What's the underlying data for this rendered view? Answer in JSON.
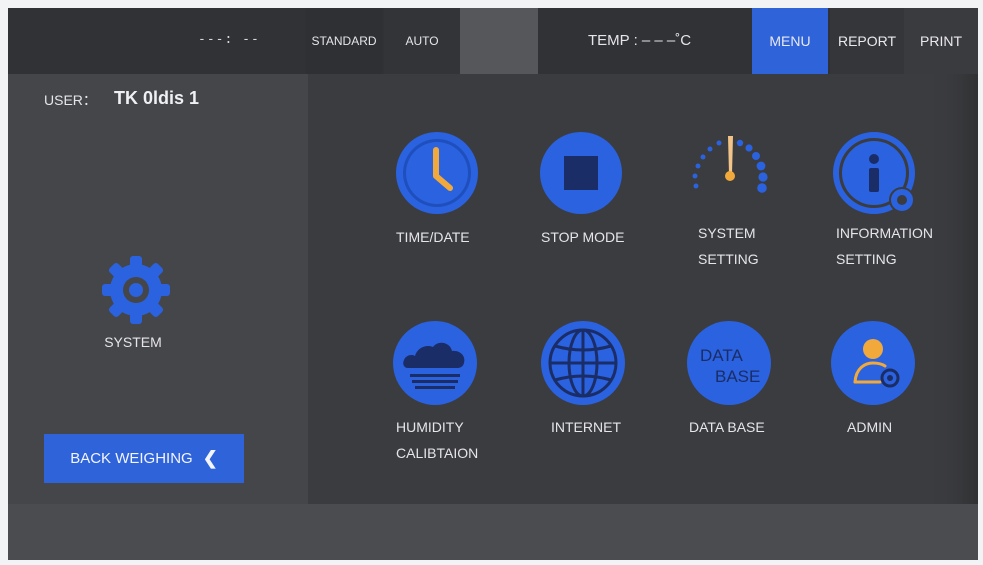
{
  "topbar": {
    "time": "---: --",
    "mode_standard": "STANDARD",
    "mode_auto": "AUTO",
    "temp": "TEMP  : – – –˚C",
    "tabs": [
      "MENU",
      "REPORT",
      "PRINT"
    ],
    "active_tab": "MENU"
  },
  "left": {
    "user_label": "USER：",
    "user_value": "TK 0ldis 1",
    "system_label": "SYSTEM",
    "back_label": "BACK WEIGHING",
    "back_icon": "chevron-left-icon"
  },
  "tiles": [
    {
      "id": "time-date",
      "label": "TIME/DATE",
      "icon": "clock-icon"
    },
    {
      "id": "stop-mode",
      "label": "STOP MODE",
      "icon": "stop-icon"
    },
    {
      "id": "system-setting",
      "label_line1": "SYSTEM",
      "label_line2": "SETTING",
      "icon": "gauge-icon"
    },
    {
      "id": "information-setting",
      "label_line1": "INFORMATION",
      "label_line2": "SETTING",
      "icon": "info-gear-icon"
    },
    {
      "id": "humidity-calibration",
      "label_line1": "HUMIDITY",
      "label_line2": "CALIBTAION",
      "icon": "cloud-icon"
    },
    {
      "id": "internet",
      "label": "INTERNET",
      "icon": "globe-icon"
    },
    {
      "id": "data-base",
      "label": "DATA BASE",
      "icon": "database-icon",
      "icon_text_1": "DATA",
      "icon_text_2": "BASE"
    },
    {
      "id": "admin",
      "label": "ADMIN",
      "icon": "admin-icon"
    }
  ],
  "colors": {
    "accent": "#2f63d9",
    "icon_blue": "#2a62e0",
    "clock_hand": "#f2a93b",
    "background": "#3b3c3f"
  }
}
